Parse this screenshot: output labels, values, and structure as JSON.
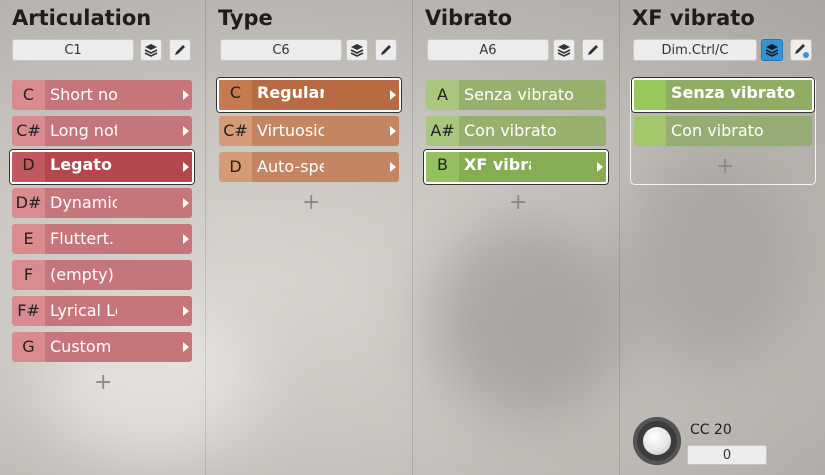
{
  "columns": {
    "articulation": {
      "title": "Articulation",
      "key": "C1",
      "items": [
        {
          "note": "C",
          "label": "Short notes",
          "selected": false
        },
        {
          "note": "C#",
          "label": "Long notes",
          "selected": false
        },
        {
          "note": "D",
          "label": "Legato",
          "selected": true
        },
        {
          "note": "D#",
          "label": "Dynamics",
          "selected": false
        },
        {
          "note": "E",
          "label": "Fluttert. & trills",
          "selected": false
        },
        {
          "note": "F",
          "label": "(empty)",
          "selected": false
        },
        {
          "note": "F#",
          "label": "Lyrical Legato",
          "selected": false
        },
        {
          "note": "G",
          "label": "Custom",
          "selected": false
        }
      ]
    },
    "type": {
      "title": "Type",
      "key": "C6",
      "items": [
        {
          "note": "C",
          "label": "Regular legato",
          "selected": true
        },
        {
          "note": "C#",
          "label": "Virtuosic legato",
          "selected": false
        },
        {
          "note": "D",
          "label": "Auto-speed",
          "selected": false
        }
      ]
    },
    "vibrato": {
      "title": "Vibrato",
      "key": "A6",
      "items": [
        {
          "note": "A",
          "label": "Senza vibrato",
          "selected": false
        },
        {
          "note": "A#",
          "label": "Con vibrato",
          "selected": false
        },
        {
          "note": "B",
          "label": "XF vibrato",
          "selected": true
        }
      ]
    },
    "xf_vibrato": {
      "title": "XF vibrato",
      "key": "Dim.Ctrl/C",
      "items": [
        {
          "note": "",
          "label": "Senza vibrato",
          "selected": true
        },
        {
          "note": "",
          "label": "Con vibrato",
          "selected": false
        }
      ]
    }
  },
  "add_symbol": "+",
  "cc": {
    "label": "CC 20",
    "value": "0"
  },
  "icons": {
    "layers": "layers-icon",
    "edit": "pencil-icon",
    "arrow": "chevron-right-icon"
  },
  "colors": {
    "accent_blue": "#2f95d6",
    "articulation": "#c6767a",
    "type": "#c48563",
    "vibrato": "#97b06d"
  }
}
